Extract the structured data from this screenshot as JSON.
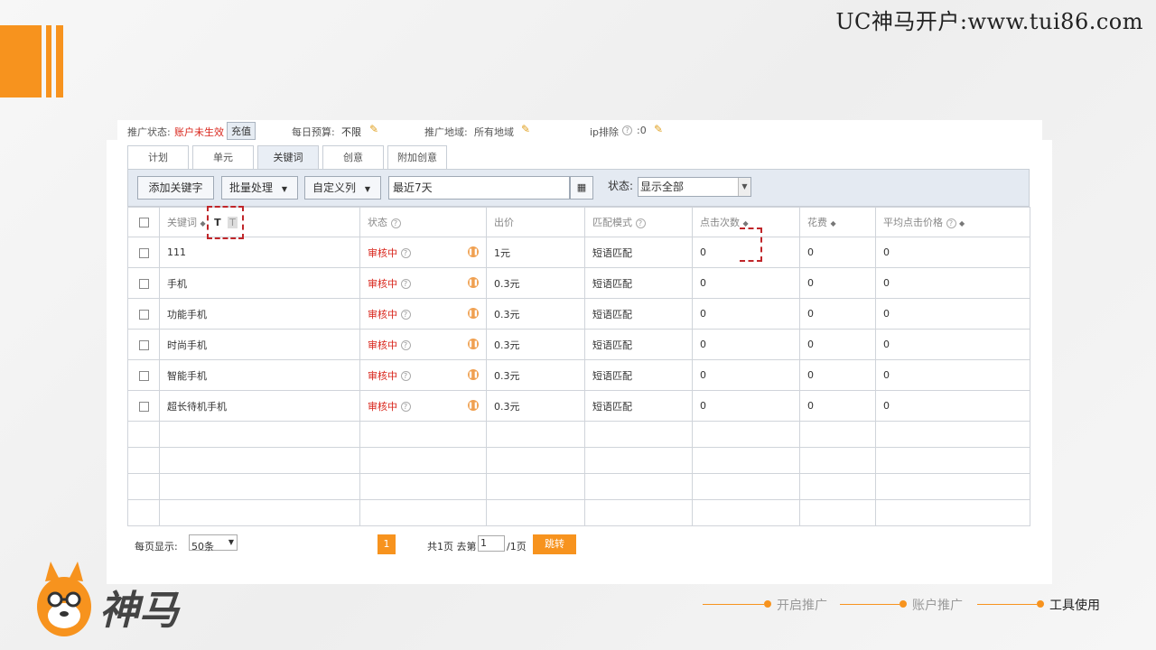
{
  "header": {
    "site_text": "UC神马开户:www.tui86.com"
  },
  "status_bar": {
    "promo_status_label": "推广状态:",
    "promo_status_value": "账户未生效",
    "recharge_label": "充值",
    "daily_budget_label": "每日预算:",
    "daily_budget_value": "不限",
    "region_label": "推广地域:",
    "region_value": "所有地域",
    "ip_exclude_label": "ip排除",
    "ip_exclude_value": ":0"
  },
  "tabs": [
    {
      "label": "计划"
    },
    {
      "label": "单元"
    },
    {
      "label": "关键词"
    },
    {
      "label": "创意"
    },
    {
      "label": "附加创意"
    }
  ],
  "toolbar": {
    "add_keyword": "添加关键字",
    "batch": "批量处理",
    "custom_columns": "自定义列",
    "date_range": "最近7天",
    "status_label": "状态:",
    "status_value": "显示全部"
  },
  "table": {
    "headers": {
      "keyword": "关键词",
      "status": "状态",
      "bid": "出价",
      "match": "匹配模式",
      "clicks": "点击次数",
      "cost": "花费",
      "avg_cpc": "平均点击价格"
    },
    "rows": [
      {
        "keyword": "111",
        "status": "审核中",
        "bid": "1元",
        "match": "短语匹配",
        "clicks": "0",
        "cost": "0",
        "avg_cpc": "0"
      },
      {
        "keyword": "手机",
        "status": "审核中",
        "bid": "0.3元",
        "match": "短语匹配",
        "clicks": "0",
        "cost": "0",
        "avg_cpc": "0"
      },
      {
        "keyword": "功能手机",
        "status": "审核中",
        "bid": "0.3元",
        "match": "短语匹配",
        "clicks": "0",
        "cost": "0",
        "avg_cpc": "0"
      },
      {
        "keyword": "时尚手机",
        "status": "审核中",
        "bid": "0.3元",
        "match": "短语匹配",
        "clicks": "0",
        "cost": "0",
        "avg_cpc": "0"
      },
      {
        "keyword": "智能手机",
        "status": "审核中",
        "bid": "0.3元",
        "match": "短语匹配",
        "clicks": "0",
        "cost": "0",
        "avg_cpc": "0"
      },
      {
        "keyword": "超长待机手机",
        "status": "审核中",
        "bid": "0.3元",
        "match": "短语匹配",
        "clicks": "0",
        "cost": "0",
        "avg_cpc": "0"
      }
    ],
    "sort_text_icons": [
      "T",
      "T"
    ]
  },
  "pager": {
    "per_page_label": "每页显示:",
    "per_page_value": "50条",
    "current_page": "1",
    "total_text": "共1页 去第",
    "goto_value": "1",
    "of_text": "/1页",
    "jump_label": "跳转"
  },
  "brand": {
    "logo_text": "神马"
  },
  "nav": [
    {
      "label": "开启推广"
    },
    {
      "label": "账户推广"
    },
    {
      "label": "工具使用"
    }
  ],
  "colors": {
    "accent": "#f7931e",
    "status_red": "#d9261c"
  }
}
